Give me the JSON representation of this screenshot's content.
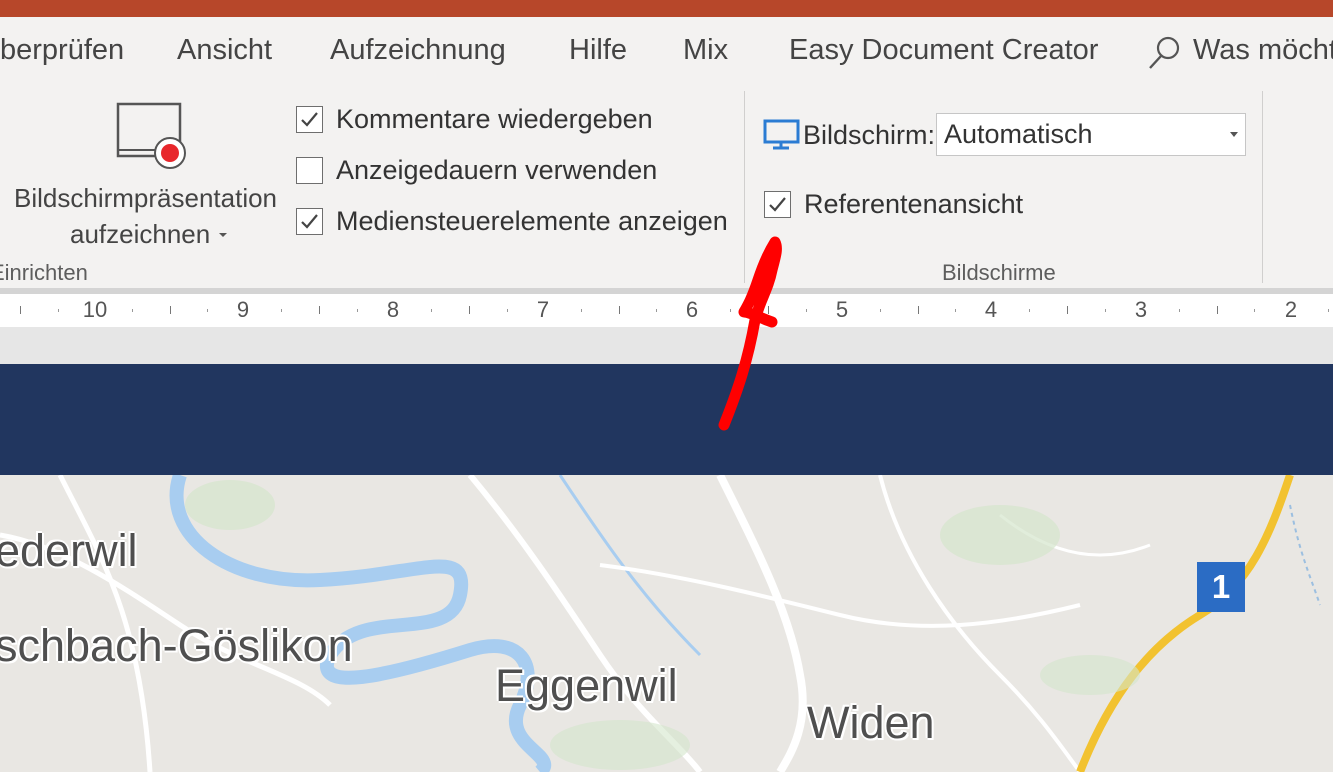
{
  "tabs": [
    "berprüfen",
    "Ansicht",
    "Aufzeichnung",
    "Hilfe",
    "Mix",
    "Easy Document Creator"
  ],
  "tell_me": {
    "text": "Was möcht"
  },
  "record_button": {
    "line1": "Bildschirmpräsentation",
    "line2": "aufzeichnen"
  },
  "einrichten": {
    "label": "Einrichten",
    "checkboxes": [
      {
        "label": "Kommentare wiedergeben",
        "checked": true
      },
      {
        "label": "Anzeigedauern verwenden",
        "checked": false
      },
      {
        "label": "Mediensteuerelemente anzeigen",
        "checked": true
      }
    ]
  },
  "bildschirme": {
    "label": "Bildschirme",
    "monitor_label": "Bildschirm:",
    "monitor_value": "Automatisch",
    "presenter_view": {
      "label": "Referentenansicht",
      "checked": true
    }
  },
  "ruler": [
    "10",
    "9",
    "8",
    "7",
    "6",
    "5",
    "4",
    "3",
    "2"
  ],
  "map": {
    "labels": [
      "ederwil",
      "schbach-Göslikon",
      "Eggenwil",
      "Widen"
    ],
    "route_badge": "1"
  },
  "icons": [
    "record-screen-icon",
    "monitor-icon",
    "search-icon",
    "dropdown-arrow-icon",
    "checkmark-icon"
  ],
  "colors": {
    "title_bar": "#b7472a",
    "slide_banner": "#21365f",
    "annotation": "#ff0000",
    "route_badge": "#2b6cc4",
    "record_dot": "#e8272c",
    "monitor_icon": "#2b7cd3"
  }
}
